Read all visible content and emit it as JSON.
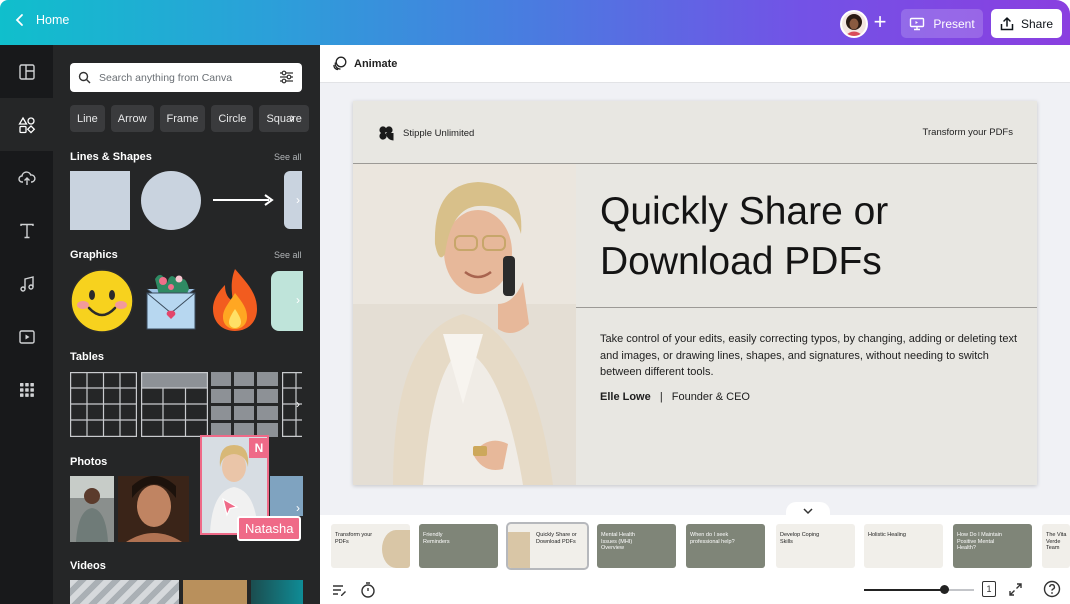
{
  "topbar": {
    "home_label": "Home",
    "present_label": "Present",
    "share_label": "Share",
    "add_icon": "plus-icon"
  },
  "panel": {
    "search_placeholder": "Search anything from Canva",
    "chips": [
      "Line",
      "Arrow",
      "Frame",
      "Circle",
      "Square"
    ],
    "sections": {
      "lines": "Lines & Shapes",
      "graphics": "Graphics",
      "tables": "Tables",
      "photos": "Photos",
      "videos": "Videos",
      "see_all": "See all"
    },
    "collaborator": {
      "initial": "N",
      "name": "Natasha",
      "color": "#ef6a88"
    }
  },
  "toolbar": {
    "animate_label": "Animate"
  },
  "slide": {
    "brand": "Stipple Unlimited",
    "tagline": "Transform your PDFs",
    "headline_1": "Quickly Share or",
    "headline_2": "Download PDFs",
    "body": "Take control of your edits, easily correcting typos, by changing, adding or deleting text and images, or drawing lines, shapes, and signatures, without needing to switch between different tools.",
    "author": "Elle Lowe",
    "separator": "|",
    "role": "Founder & CEO"
  },
  "thumbnails": [
    {
      "title": "Transform your PDFs",
      "style": "light"
    },
    {
      "title": "Friendly Reminders",
      "style": "dark"
    },
    {
      "title": "Quickly Share or Download PDFs",
      "style": "light",
      "active": true
    },
    {
      "title": "Mental Health Issues (MHI) Overview",
      "style": "dark"
    },
    {
      "title": "When do I seek professional help?",
      "style": "dark"
    },
    {
      "title": "Develop Coping Skills",
      "style": "light"
    },
    {
      "title": "Holistic Healing",
      "style": "light"
    },
    {
      "title": "How Do I Maintain Positive Mental Health?",
      "style": "dark"
    },
    {
      "title": "The Vita Verde Team",
      "style": "light"
    }
  ],
  "zoom": {
    "level_fraction": 0.73,
    "page_label": "1"
  },
  "colors": {
    "accent": "#7352e6",
    "panel": "#252627",
    "rail": "#18191b",
    "slide_bg": "#e8e7e2",
    "thumb_dark": "#7f8578"
  }
}
